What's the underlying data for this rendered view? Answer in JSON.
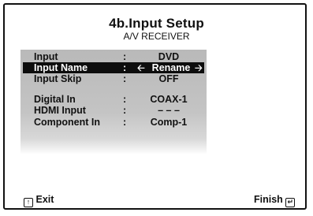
{
  "title": "4b.Input Setup",
  "subtitle": "A/V RECEIVER",
  "menu": {
    "items": [
      {
        "label": "Input",
        "value": "DVD",
        "selected": false
      },
      {
        "label": "Input Name",
        "value": "Rename",
        "selected": true
      },
      {
        "label": "Input Skip",
        "value": "OFF",
        "selected": false
      },
      {
        "label": "Digital In",
        "value": "COAX-1",
        "selected": false
      },
      {
        "label": "HDMI Input",
        "value": "– – –",
        "selected": false
      },
      {
        "label": "Component In",
        "value": "Comp-1",
        "selected": false
      }
    ],
    "separator": ":"
  },
  "footer": {
    "exit_label": "Exit",
    "finish_label": "Finish"
  },
  "icons": {
    "left_arrow": "left-arrow-icon",
    "right_arrow": "right-arrow-icon",
    "exit": "return-icon",
    "finish": "enter-icon"
  },
  "colors": {
    "highlight_bg": "#0d0d0d",
    "highlight_text": "#ffffff",
    "panel_bg": "#c0c0c0"
  }
}
